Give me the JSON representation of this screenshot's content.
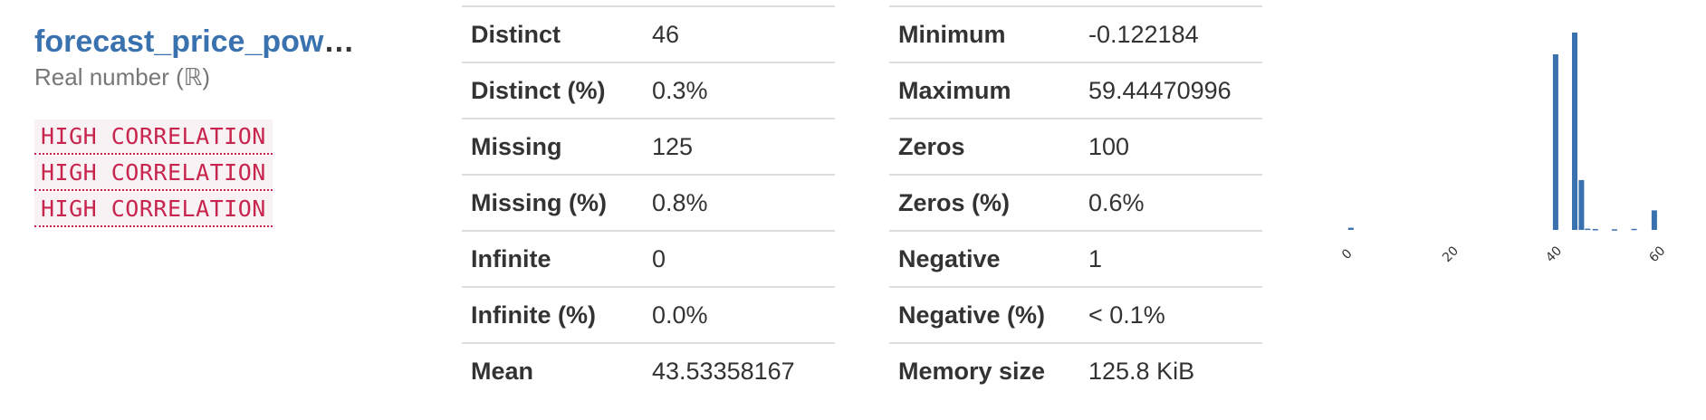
{
  "variable": {
    "name": "forecast_price_pow",
    "name_ellipsis": "…",
    "type": "Real number (ℝ)",
    "badges": [
      "HIGH CORRELATION",
      "HIGH CORRELATION",
      "HIGH CORRELATION"
    ]
  },
  "stats_left": [
    {
      "label": "Distinct",
      "value": "46"
    },
    {
      "label": "Distinct (%)",
      "value": "0.3%"
    },
    {
      "label": "Missing",
      "value": "125"
    },
    {
      "label": "Missing (%)",
      "value": "0.8%"
    },
    {
      "label": "Infinite",
      "value": "0"
    },
    {
      "label": "Infinite (%)",
      "value": "0.0%"
    },
    {
      "label": "Mean",
      "value": "43.53358167"
    }
  ],
  "stats_right": [
    {
      "label": "Minimum",
      "value": "-0.122184"
    },
    {
      "label": "Maximum",
      "value": "59.44470996"
    },
    {
      "label": "Zeros",
      "value": "100"
    },
    {
      "label": "Zeros (%)",
      "value": "0.6%"
    },
    {
      "label": "Negative",
      "value": "1"
    },
    {
      "label": "Negative (%)",
      "value": "< 0.1%"
    },
    {
      "label": "Memory size",
      "value": "125.8 KiB"
    }
  ],
  "chart_data": {
    "type": "bar",
    "bar_color": "#3a72b0",
    "xlim": [
      -0.122184,
      59.44470996
    ],
    "ticks": [
      {
        "value": 0,
        "label": "0"
      },
      {
        "value": 20,
        "label": "20"
      },
      {
        "value": 40,
        "label": "40"
      },
      {
        "value": 60,
        "label": "60"
      }
    ],
    "bins": [
      {
        "x": 0.2,
        "count": 100
      },
      {
        "x": 39.8,
        "count": 8100
      },
      {
        "x": 43.5,
        "count": 9100
      },
      {
        "x": 44.8,
        "count": 2300
      },
      {
        "x": 46.0,
        "count": 60
      },
      {
        "x": 47.5,
        "count": 40
      },
      {
        "x": 51.2,
        "count": 30
      },
      {
        "x": 55.0,
        "count": 50
      },
      {
        "x": 58.9,
        "count": 900
      }
    ],
    "ylim": [
      0,
      9100
    ],
    "grid": false,
    "legend": "none"
  }
}
